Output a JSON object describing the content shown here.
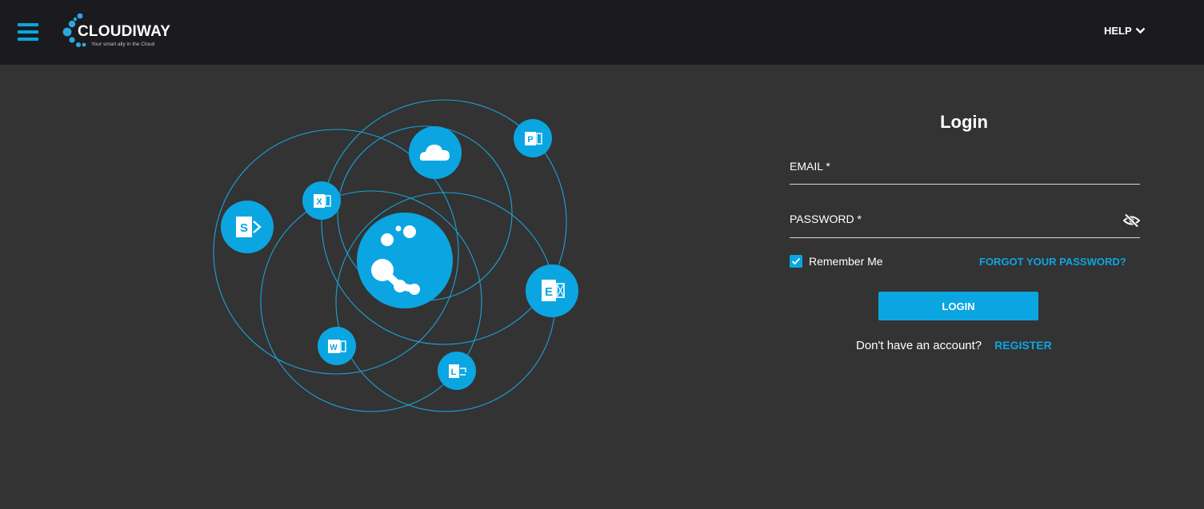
{
  "header": {
    "brand_name": "CLOUDIWAY",
    "brand_tagline": "Your smart ally in the Cloud",
    "help_label": "HELP"
  },
  "illustration": {
    "nodes": {
      "sharepoint": "S",
      "excel": "X",
      "onedrive": "onedrive-cloud",
      "powerpoint": "P",
      "exchange": "E",
      "word": "W",
      "lync": "L"
    }
  },
  "login": {
    "title": "Login",
    "email_label": "EMAIL *",
    "email_value": "",
    "password_label": "PASSWORD *",
    "password_value": "",
    "remember_label": "Remember Me",
    "remember_checked": true,
    "forgot_label": "FORGOT YOUR PASSWORD?",
    "submit_label": "LOGIN",
    "no_account_text": "Don't have an account?",
    "register_label": "REGISTER"
  },
  "colors": {
    "accent": "#0ba6e1",
    "background": "#333333",
    "topbar": "#1b1b1f"
  }
}
